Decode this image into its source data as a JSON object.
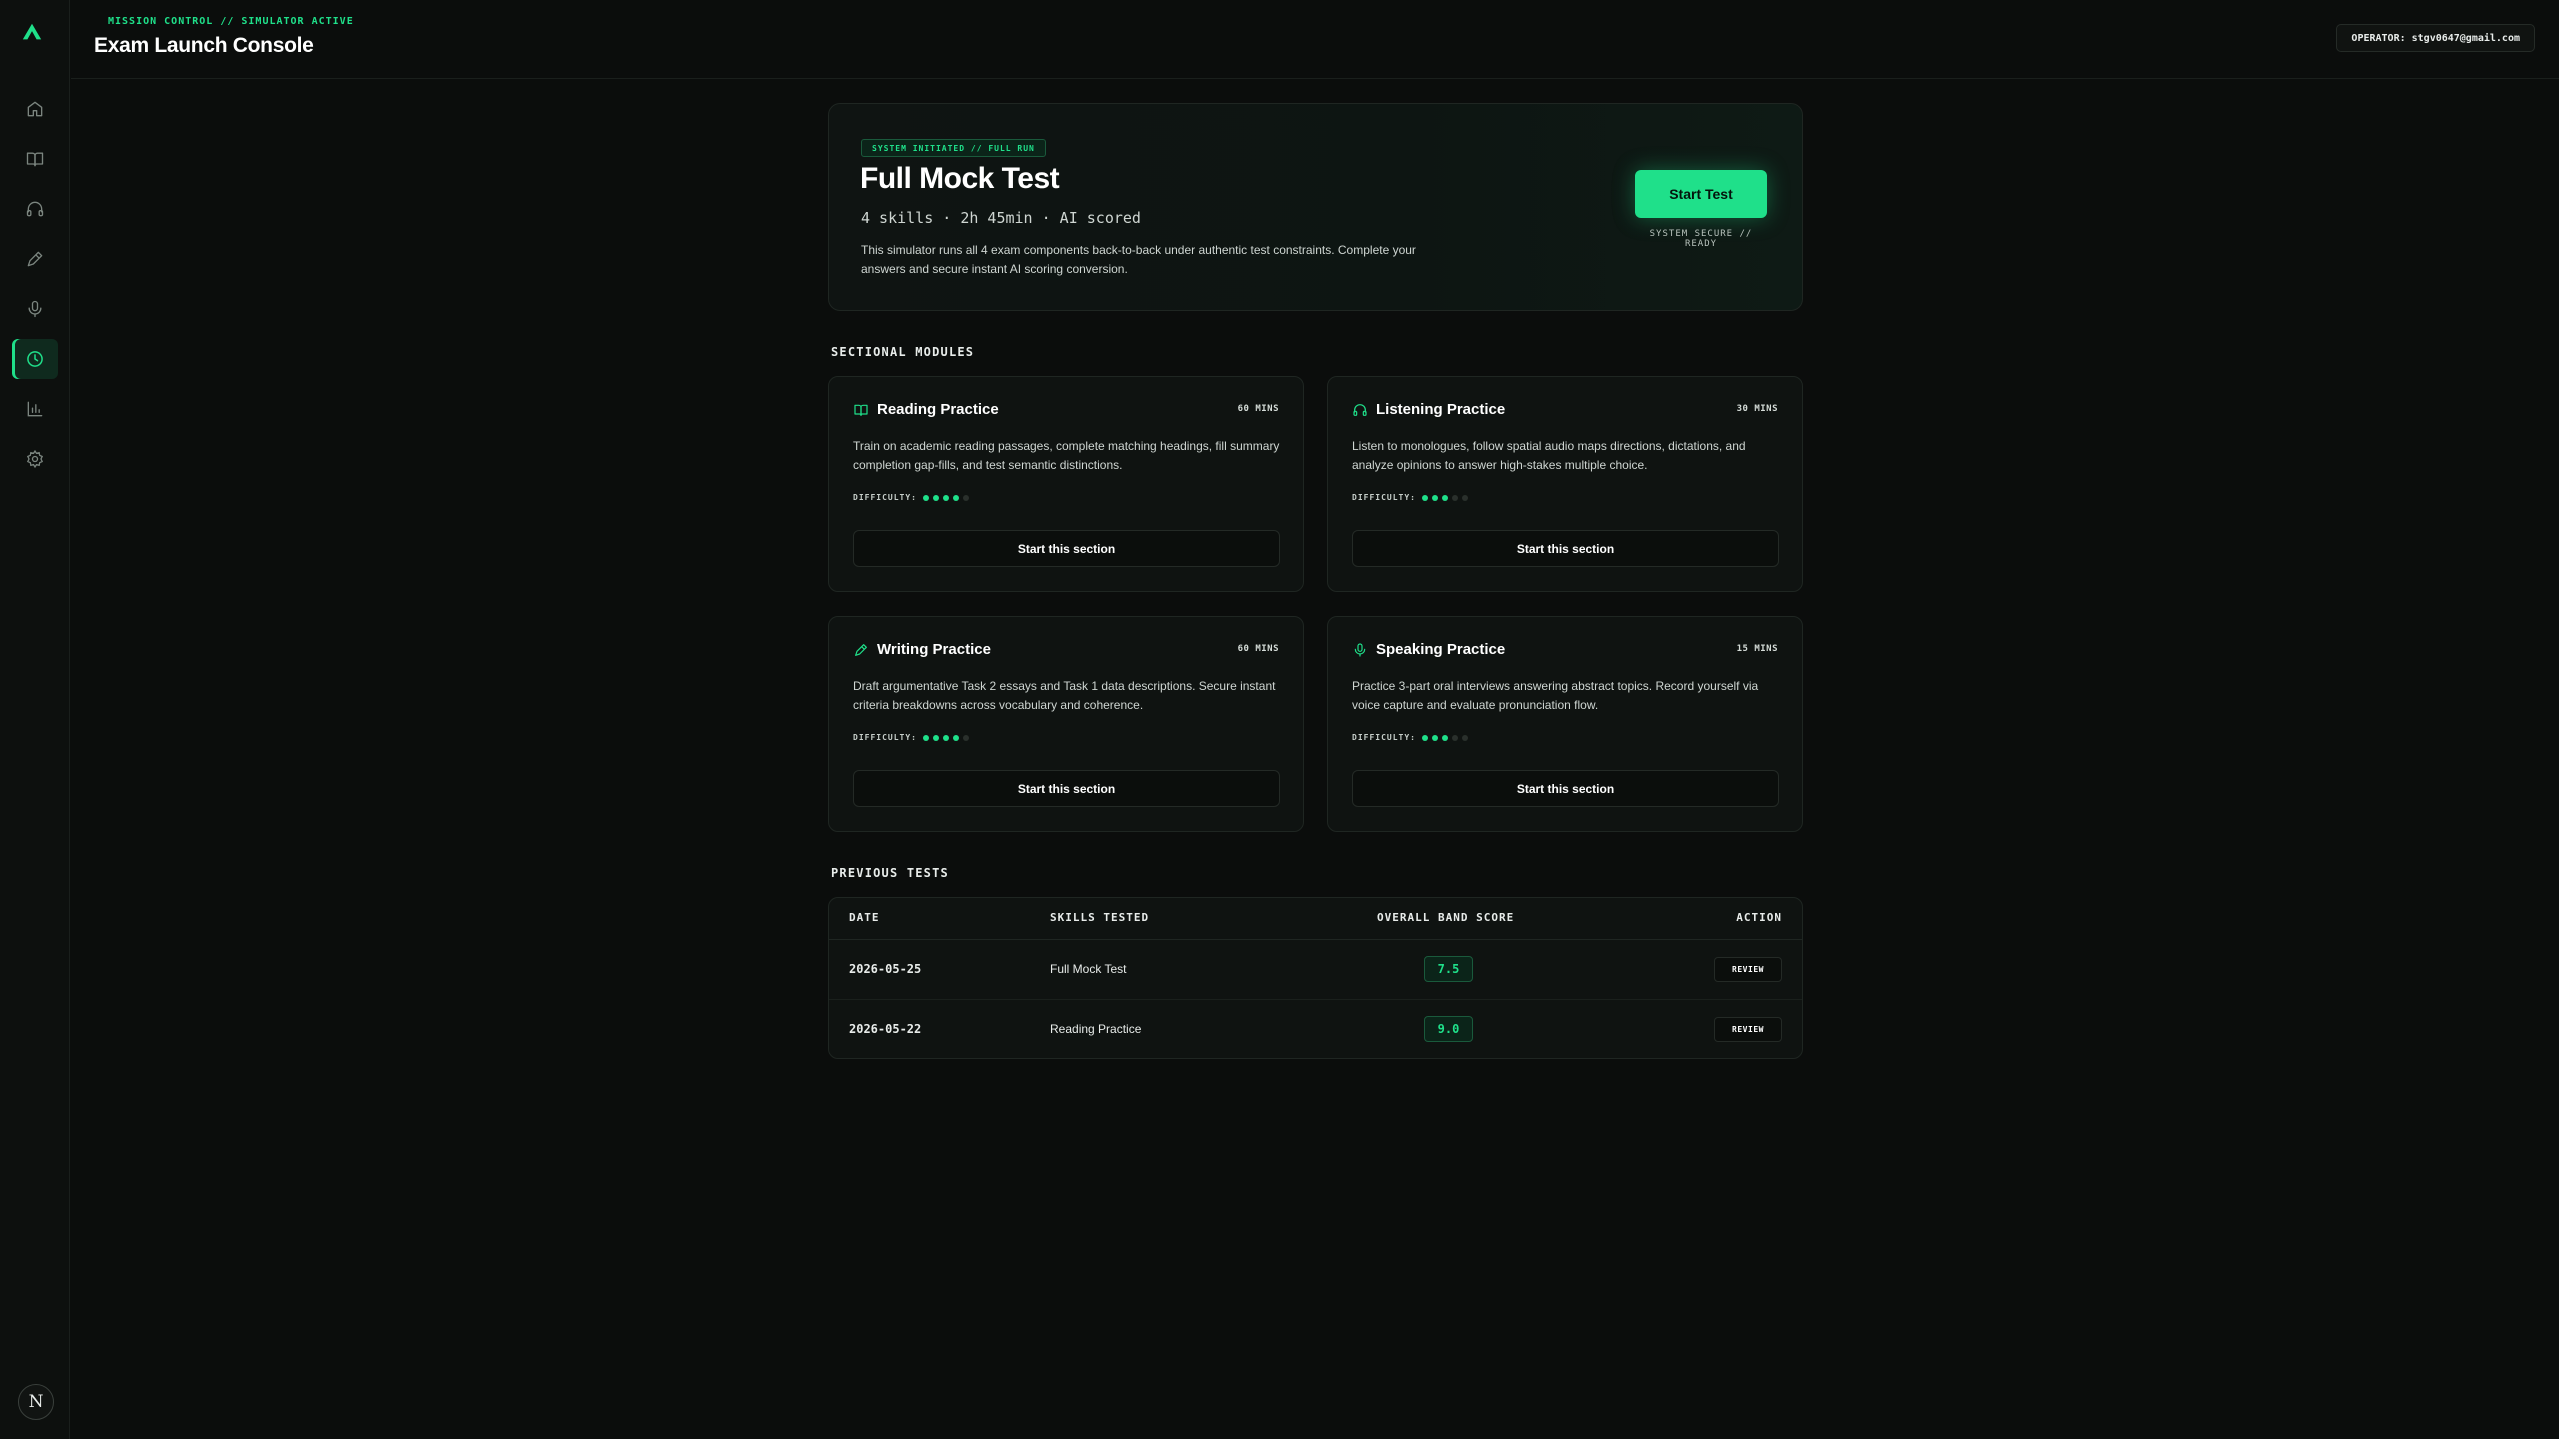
{
  "header": {
    "crumb": "MISSION CONTROL // SIMULATOR ACTIVE",
    "title": "Exam Launch Console",
    "operator": "OPERATOR: stgv0647@gmail.com"
  },
  "sidebar": {
    "items": [
      {
        "icon": "home-icon"
      },
      {
        "icon": "book-icon"
      },
      {
        "icon": "headphones-icon"
      },
      {
        "icon": "pen-icon"
      },
      {
        "icon": "mic-icon"
      },
      {
        "icon": "clock-icon",
        "active": true
      },
      {
        "icon": "bar-chart-icon"
      },
      {
        "icon": "gear-icon"
      }
    ],
    "avatar_letter": "N"
  },
  "hero": {
    "badge": "SYSTEM INITIATED // FULL RUN",
    "title": "Full Mock Test",
    "meta": "4 skills · 2h 45min · AI scored",
    "description": "This simulator runs all 4 exam components back-to-back under authentic test constraints. Complete your answers and secure instant AI scoring conversion.",
    "start_label": "Start Test",
    "status": "SYSTEM SECURE // READY"
  },
  "sections_label": "SECTIONAL MODULES",
  "modules": [
    {
      "title": "Reading Practice",
      "icon": "book-icon",
      "duration": "60 MINS",
      "description": "Train on academic reading passages, complete matching headings, fill summary completion gap-fills, and test semantic distinctions.",
      "difficulty_label": "DIFFICULTY:",
      "difficulty": 4,
      "button": "Start this section"
    },
    {
      "title": "Listening Practice",
      "icon": "headphones-icon",
      "duration": "30 MINS",
      "description": "Listen to monologues, follow spatial audio maps directions, dictations, and analyze opinions to answer high-stakes multiple choice.",
      "difficulty_label": "DIFFICULTY:",
      "difficulty": 3,
      "button": "Start this section"
    },
    {
      "title": "Writing Practice",
      "icon": "pen-icon",
      "duration": "60 MINS",
      "description": "Draft argumentative Task 2 essays and Task 1 data descriptions. Secure instant criteria breakdowns across vocabulary and coherence.",
      "difficulty_label": "DIFFICULTY:",
      "difficulty": 4,
      "button": "Start this section"
    },
    {
      "title": "Speaking Practice",
      "icon": "mic-icon",
      "duration": "15 MINS",
      "description": "Practice 3-part oral interviews answering abstract topics. Record yourself via voice capture and evaluate pronunciation flow.",
      "difficulty_label": "DIFFICULTY:",
      "difficulty": 3,
      "button": "Start this section"
    }
  ],
  "previous_label": "PREVIOUS TESTS",
  "table": {
    "headers": [
      "DATE",
      "SKILLS TESTED",
      "OVERALL BAND SCORE",
      "ACTION"
    ],
    "rows": [
      {
        "date": "2026-05-25",
        "skills": "Full Mock Test",
        "score": "7.5",
        "action": "REVIEW"
      },
      {
        "date": "2026-05-22",
        "skills": "Reading Practice",
        "score": "9.0",
        "action": "REVIEW"
      }
    ]
  },
  "colors": {
    "accent": "#1fe08a",
    "background": "#0b0d0c",
    "card": "#0f1311"
  }
}
